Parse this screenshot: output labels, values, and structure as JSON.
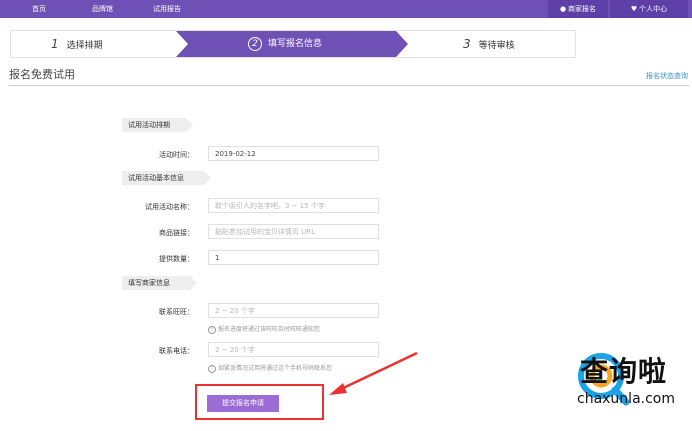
{
  "nav": {
    "items": [
      "首页",
      "品牌馆",
      "试用报告"
    ],
    "merchant_signup": "商家报名",
    "user_center": "个人中心"
  },
  "steps": [
    {
      "num": "1",
      "label": "选择排期"
    },
    {
      "num": "2",
      "label": "填写报名信息"
    },
    {
      "num": "3",
      "label": "等待审核"
    }
  ],
  "page": {
    "title": "报名免费试用",
    "status_link": "报名状态查询"
  },
  "sections": {
    "schedule": "试用活动排期",
    "basic": "试用活动基本信息",
    "merchant": "填写商家信息"
  },
  "fields": {
    "activity_time": {
      "label": "活动时间：",
      "value": "2019-02-12"
    },
    "activity_name": {
      "label": "试用活动名称：",
      "placeholder": "取个吸引人的名字吧，3 ~ 15 个字"
    },
    "product_link": {
      "label": "商品链接：",
      "placeholder": "黏贴参加试用的宝贝详情页 URL"
    },
    "quantity": {
      "label": "提供数量：",
      "value": "1"
    },
    "wangwang": {
      "label": "联系旺旺：",
      "placeholder": "2 ~ 20 个字",
      "hint": "报名进度将通过该旺旺及时旺旺通知您"
    },
    "phone": {
      "label": "联系电话：",
      "placeholder": "2 ~ 20 个字",
      "hint": "如紧急情况试用将通过这个手机号码联系您"
    }
  },
  "submit_label": "提交报名申请",
  "watermark": {
    "text": "查询啦",
    "url": "chaxunla.com"
  },
  "colors": {
    "brand": "#6f50b5",
    "button": "#9b6bd6",
    "highlight": "#e8332e"
  }
}
